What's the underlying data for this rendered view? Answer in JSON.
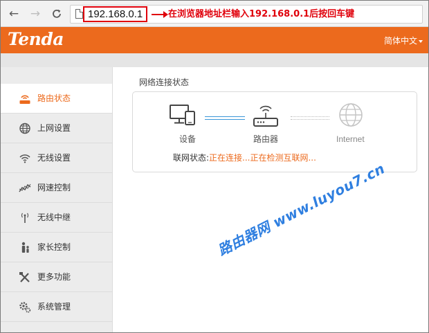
{
  "browser": {
    "url": "192.168.0.1",
    "annotation": "在浏览器地址栏输入192.168.0.1后按回车键",
    "back_icon": "arrow-left",
    "forward_icon": "arrow-right",
    "reload_icon": "reload",
    "annotation_color": "#e0000b"
  },
  "header": {
    "logo": "Tenda",
    "language": "简体中文",
    "accent_color": "#ec6a1d"
  },
  "sidebar": {
    "items": [
      {
        "label": "路由状态",
        "icon": "router-status-icon",
        "active": true
      },
      {
        "label": "上网设置",
        "icon": "globe-icon",
        "active": false
      },
      {
        "label": "无线设置",
        "icon": "wifi-icon",
        "active": false
      },
      {
        "label": "网速控制",
        "icon": "speed-chart-icon",
        "active": false
      },
      {
        "label": "无线中继",
        "icon": "antenna-icon",
        "active": false
      },
      {
        "label": "家长控制",
        "icon": "family-icon",
        "active": false
      },
      {
        "label": "更多功能",
        "icon": "tools-icon",
        "active": false
      },
      {
        "label": "系统管理",
        "icon": "gears-icon",
        "active": false
      }
    ]
  },
  "main": {
    "section_title": "网络连接状态",
    "devices": {
      "device_label": "设备",
      "router_label": "路由器",
      "internet_label": "Internet"
    },
    "status_label": "联网状态:",
    "status_value": "正在连接...正在检测互联网..."
  },
  "watermark": "路由器网 www.luyou7.cn"
}
